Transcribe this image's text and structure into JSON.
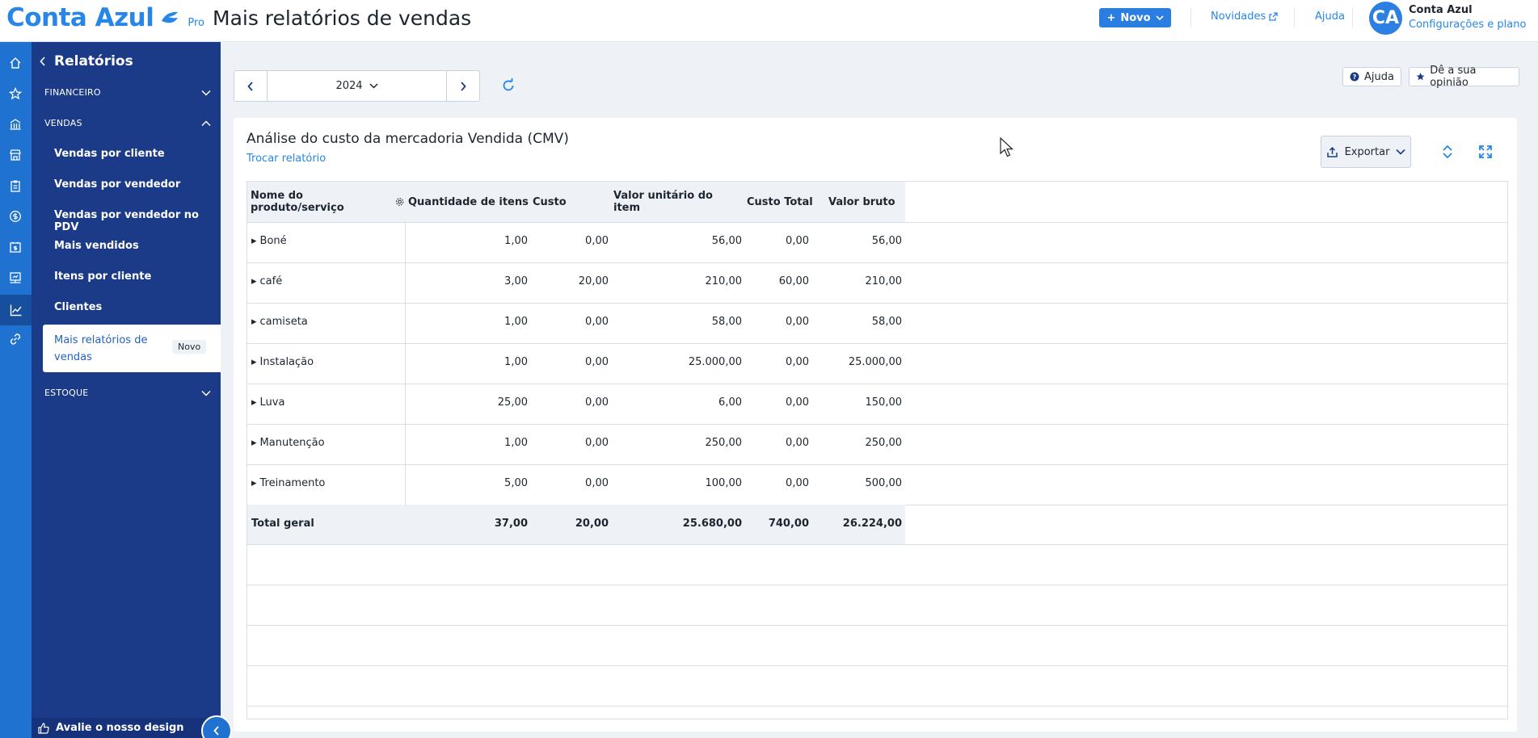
{
  "header": {
    "logo_text": "Conta Azul",
    "logo_plan": "Pro",
    "page_title": "Mais relatórios de vendas",
    "new_button": "Novo",
    "news_link": "Novidades",
    "help_link": "Ajuda",
    "avatar_initials": "CA",
    "user_name": "Conta Azul",
    "user_subtitle": "Configurações e plano"
  },
  "sidebar": {
    "title": "Relatórios",
    "sections": [
      {
        "label": "FINANCEIRO"
      },
      {
        "label": "VENDAS"
      },
      {
        "label": "ESTOQUE"
      }
    ],
    "items": [
      {
        "label": "Vendas por cliente"
      },
      {
        "label": "Vendas por vendedor"
      },
      {
        "label": "Vendas por vendedor no PDV"
      },
      {
        "label": "Mais vendidos"
      },
      {
        "label": "Itens por cliente"
      },
      {
        "label": "Clientes"
      }
    ],
    "active_item": {
      "label": "Mais relatórios de vendas",
      "badge": "Novo"
    },
    "footer": "Avalie o nosso design"
  },
  "filters": {
    "year": "2024",
    "help_chip": "Ajuda",
    "feedback_chip": "Dê a sua opinião"
  },
  "report": {
    "title": "Análise do custo da mercadoria Vendida (CMV)",
    "switch_link": "Trocar relatório",
    "export_button": "Exportar",
    "columns": [
      "Nome do produto/serviço",
      "Quantidade de itens",
      "Custo",
      "Valor unitário do item",
      "Custo Total",
      "Valor bruto"
    ],
    "rows": [
      {
        "name": "Boné",
        "qty": "1,00",
        "cost": "0,00",
        "unit": "56,00",
        "total_cost": "0,00",
        "gross": "56,00"
      },
      {
        "name": "café",
        "qty": "3,00",
        "cost": "20,00",
        "unit": "210,00",
        "total_cost": "60,00",
        "gross": "210,00"
      },
      {
        "name": "camiseta",
        "qty": "1,00",
        "cost": "0,00",
        "unit": "58,00",
        "total_cost": "0,00",
        "gross": "58,00"
      },
      {
        "name": "Instalação",
        "qty": "1,00",
        "cost": "0,00",
        "unit": "25.000,00",
        "total_cost": "0,00",
        "gross": "25.000,00"
      },
      {
        "name": "Luva",
        "qty": "25,00",
        "cost": "0,00",
        "unit": "6,00",
        "total_cost": "0,00",
        "gross": "150,00"
      },
      {
        "name": "Manutenção",
        "qty": "1,00",
        "cost": "0,00",
        "unit": "250,00",
        "total_cost": "0,00",
        "gross": "250,00"
      },
      {
        "name": "Treinamento",
        "qty": "5,00",
        "cost": "0,00",
        "unit": "100,00",
        "total_cost": "0,00",
        "gross": "500,00"
      }
    ],
    "total": {
      "name": "Total geral",
      "qty": "37,00",
      "cost": "20,00",
      "unit": "25.680,00",
      "total_cost": "740,00",
      "gross": "26.224,00"
    }
  },
  "colors": {
    "brand_blue": "#2687e9",
    "sidebar_navy": "#1b3a87",
    "rail_blue": "#1f72d0"
  }
}
